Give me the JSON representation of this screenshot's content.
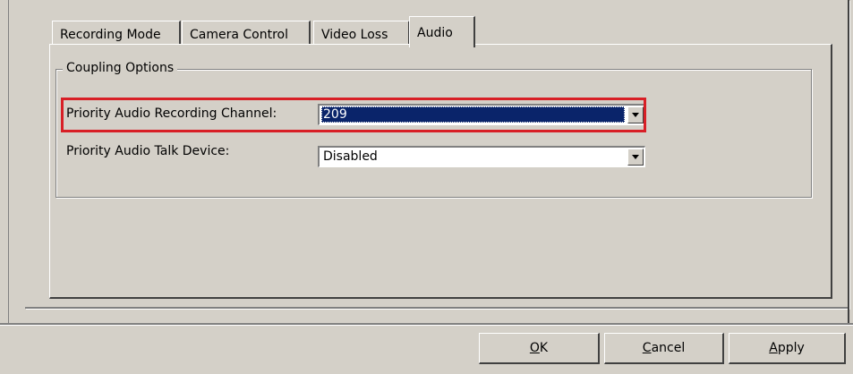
{
  "tabs": [
    {
      "label": "Recording Mode",
      "active": false
    },
    {
      "label": "Camera Control",
      "active": false
    },
    {
      "label": "Video Loss",
      "active": false
    },
    {
      "label": "Audio",
      "active": true
    }
  ],
  "group": {
    "legend": "Coupling Options"
  },
  "fields": {
    "recording_channel": {
      "label": "Priority Audio Recording Channel:",
      "value": "209"
    },
    "talk_device": {
      "label": "Priority Audio Talk Device:",
      "value": "Disabled"
    }
  },
  "buttons": {
    "ok": {
      "accel": "O",
      "rest": "K"
    },
    "cancel": {
      "accel": "C",
      "rest": "ancel"
    },
    "apply": {
      "accel": "A",
      "rest": "pply"
    }
  },
  "colors": {
    "face": "#d4d0c8",
    "selection": "#0a246a",
    "highlight": "#d81f26"
  }
}
